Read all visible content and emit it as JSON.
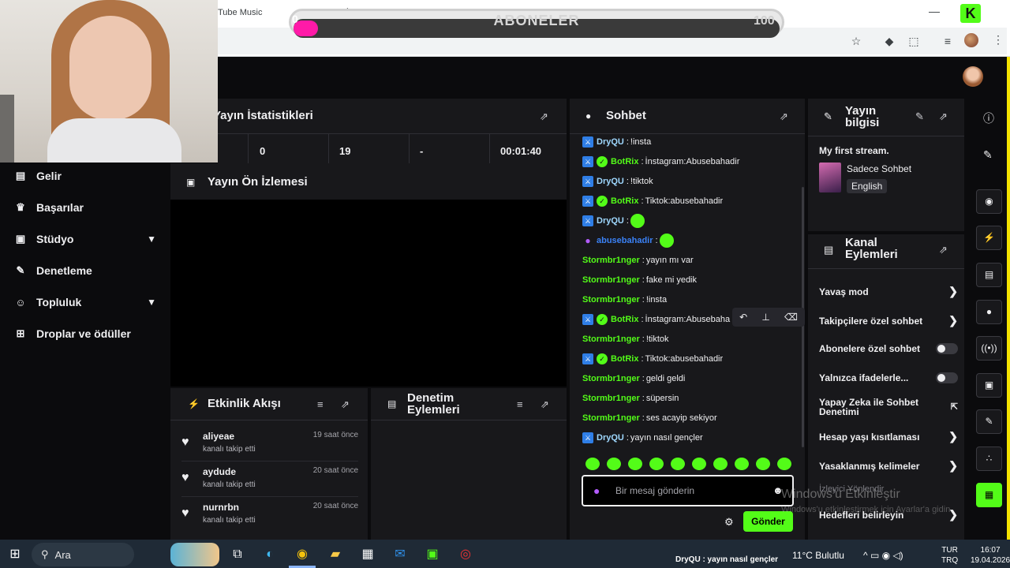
{
  "browser": {
    "tab_title": "Tube Music",
    "close_glyph": "×",
    "new_tab_glyph": "+",
    "minimize_glyph": "—",
    "kick_logo": "K"
  },
  "overlay": {
    "label": "ABONELER",
    "min": "0",
    "max": "100",
    "progress_fraction": 0.05
  },
  "nav": {
    "items": [
      {
        "label": "Gelir",
        "icon": "revenue-icon"
      },
      {
        "label": "Başarılar",
        "icon": "trophy-icon"
      },
      {
        "label": "Stüdyo",
        "icon": "studio-icon",
        "expandable": true
      },
      {
        "label": "Denetleme",
        "icon": "wrench-icon"
      },
      {
        "label": "Topluluk",
        "icon": "community-icon",
        "expandable": true
      },
      {
        "label": "Droplar ve ödüller",
        "icon": "gift-icon"
      }
    ]
  },
  "stats": {
    "title": "Yayın İstatistikleri",
    "values": [
      "0",
      "19",
      "-",
      "00:01:40"
    ]
  },
  "preview": {
    "title": "Yayın Ön İzlemesi"
  },
  "activity": {
    "title": "Etkinlik Akışı",
    "items": [
      {
        "name": "aliyeae",
        "action": "kanalı takip etti",
        "time": "19 saat önce"
      },
      {
        "name": "aydude",
        "action": "kanalı takip etti",
        "time": "20 saat önce"
      },
      {
        "name": "nurnrbn",
        "action": "kanalı takip etti",
        "time": "20 saat önce"
      }
    ]
  },
  "moderation": {
    "title_line1": "Denetim",
    "title_line2": "Eylemleri"
  },
  "chat": {
    "title": "Sohbet",
    "messages": [
      {
        "user": "DryQU",
        "color": "#9fd8ff",
        "badges": [
          "mod"
        ],
        "text": "!insta"
      },
      {
        "user": "BotRix",
        "color": "#53fc18",
        "badges": [
          "mod",
          "verified"
        ],
        "text": "İnstagram:Abusebahadir"
      },
      {
        "user": "DryQU",
        "color": "#9fd8ff",
        "badges": [
          "mod"
        ],
        "text": "!tiktok"
      },
      {
        "user": "BotRix",
        "color": "#53fc18",
        "badges": [
          "mod",
          "verified"
        ],
        "text": "Tiktok:abusebahadir"
      },
      {
        "user": "DryQU",
        "color": "#9fd8ff",
        "badges": [
          "mod"
        ],
        "text": "",
        "emote": true
      },
      {
        "user": "abusebahadir",
        "color": "#3b82f6",
        "badges": [
          "mic"
        ],
        "text": "",
        "emote": true
      },
      {
        "user": "Stormbr1nger",
        "color": "#53fc18",
        "badges": [],
        "text": "yayın mı var"
      },
      {
        "user": "Stormbr1nger",
        "color": "#53fc18",
        "badges": [],
        "text": "fake mi yedik"
      },
      {
        "user": "Stormbr1nger",
        "color": "#53fc18",
        "badges": [],
        "text": "!insta"
      },
      {
        "user": "BotRix",
        "color": "#53fc18",
        "badges": [
          "mod",
          "verified"
        ],
        "text": "İnstagram:Abusebaha"
      },
      {
        "user": "Stormbr1nger",
        "color": "#53fc18",
        "badges": [],
        "text": "!tiktok"
      },
      {
        "user": "BotRix",
        "color": "#53fc18",
        "badges": [
          "mod",
          "verified"
        ],
        "text": "Tiktok:abusebahadir"
      },
      {
        "user": "Stormbr1nger",
        "color": "#53fc18",
        "badges": [],
        "text": "geldi geldi"
      },
      {
        "user": "Stormbr1nger",
        "color": "#53fc18",
        "badges": [],
        "text": "süpersin"
      },
      {
        "user": "Stormbr1nger",
        "color": "#53fc18",
        "badges": [],
        "text": "ses acayip sekiyor"
      },
      {
        "user": "DryQU",
        "color": "#9fd8ff",
        "badges": [
          "mod"
        ],
        "text": "yayın nasıl gençler"
      }
    ],
    "input_placeholder": "Bir mesaj gönderin",
    "send_label": "Gönder"
  },
  "stream_info": {
    "title_line1": "Yayın",
    "title_line2": "bilgisi",
    "stream_title": "My first stream.",
    "category": "Sadece Sohbet",
    "language": "English"
  },
  "channel_actions": {
    "title_line1": "Kanal",
    "title_line2": "Eylemleri",
    "rows": [
      {
        "label": "Yavaş mod",
        "type": "chevron"
      },
      {
        "label": "Takipçilere özel sohbet",
        "type": "chevron"
      },
      {
        "label": "Abonelere özel sohbet",
        "type": "toggle"
      },
      {
        "label": "Yalnızca ifadelerle...",
        "type": "toggle"
      },
      {
        "label": "Yapay Zeka ile Sohbet Denetimi",
        "type": "external"
      },
      {
        "label": "Hesap yaşı kısıtlaması",
        "type": "chevron"
      },
      {
        "label": "Yasaklanmış kelimeler",
        "type": "chevron"
      },
      {
        "label": "İzleyici Yönlendir",
        "type": "none"
      },
      {
        "label": "Hedefleri belirleyin",
        "type": "chevron"
      }
    ]
  },
  "watermark": {
    "line1": "Windows'u Etkinleştir",
    "line2": "Windows'u etkinleştirmek için Ayarlar'a gidin."
  },
  "taskbar": {
    "search": "Ara",
    "notification": "DryQU : yayın nasıl gençler",
    "weather": "11°C  Bulutlu",
    "lang_line1": "TUR",
    "lang_line2": "TRQ",
    "time": "16:07",
    "date": "19.04.2026"
  }
}
